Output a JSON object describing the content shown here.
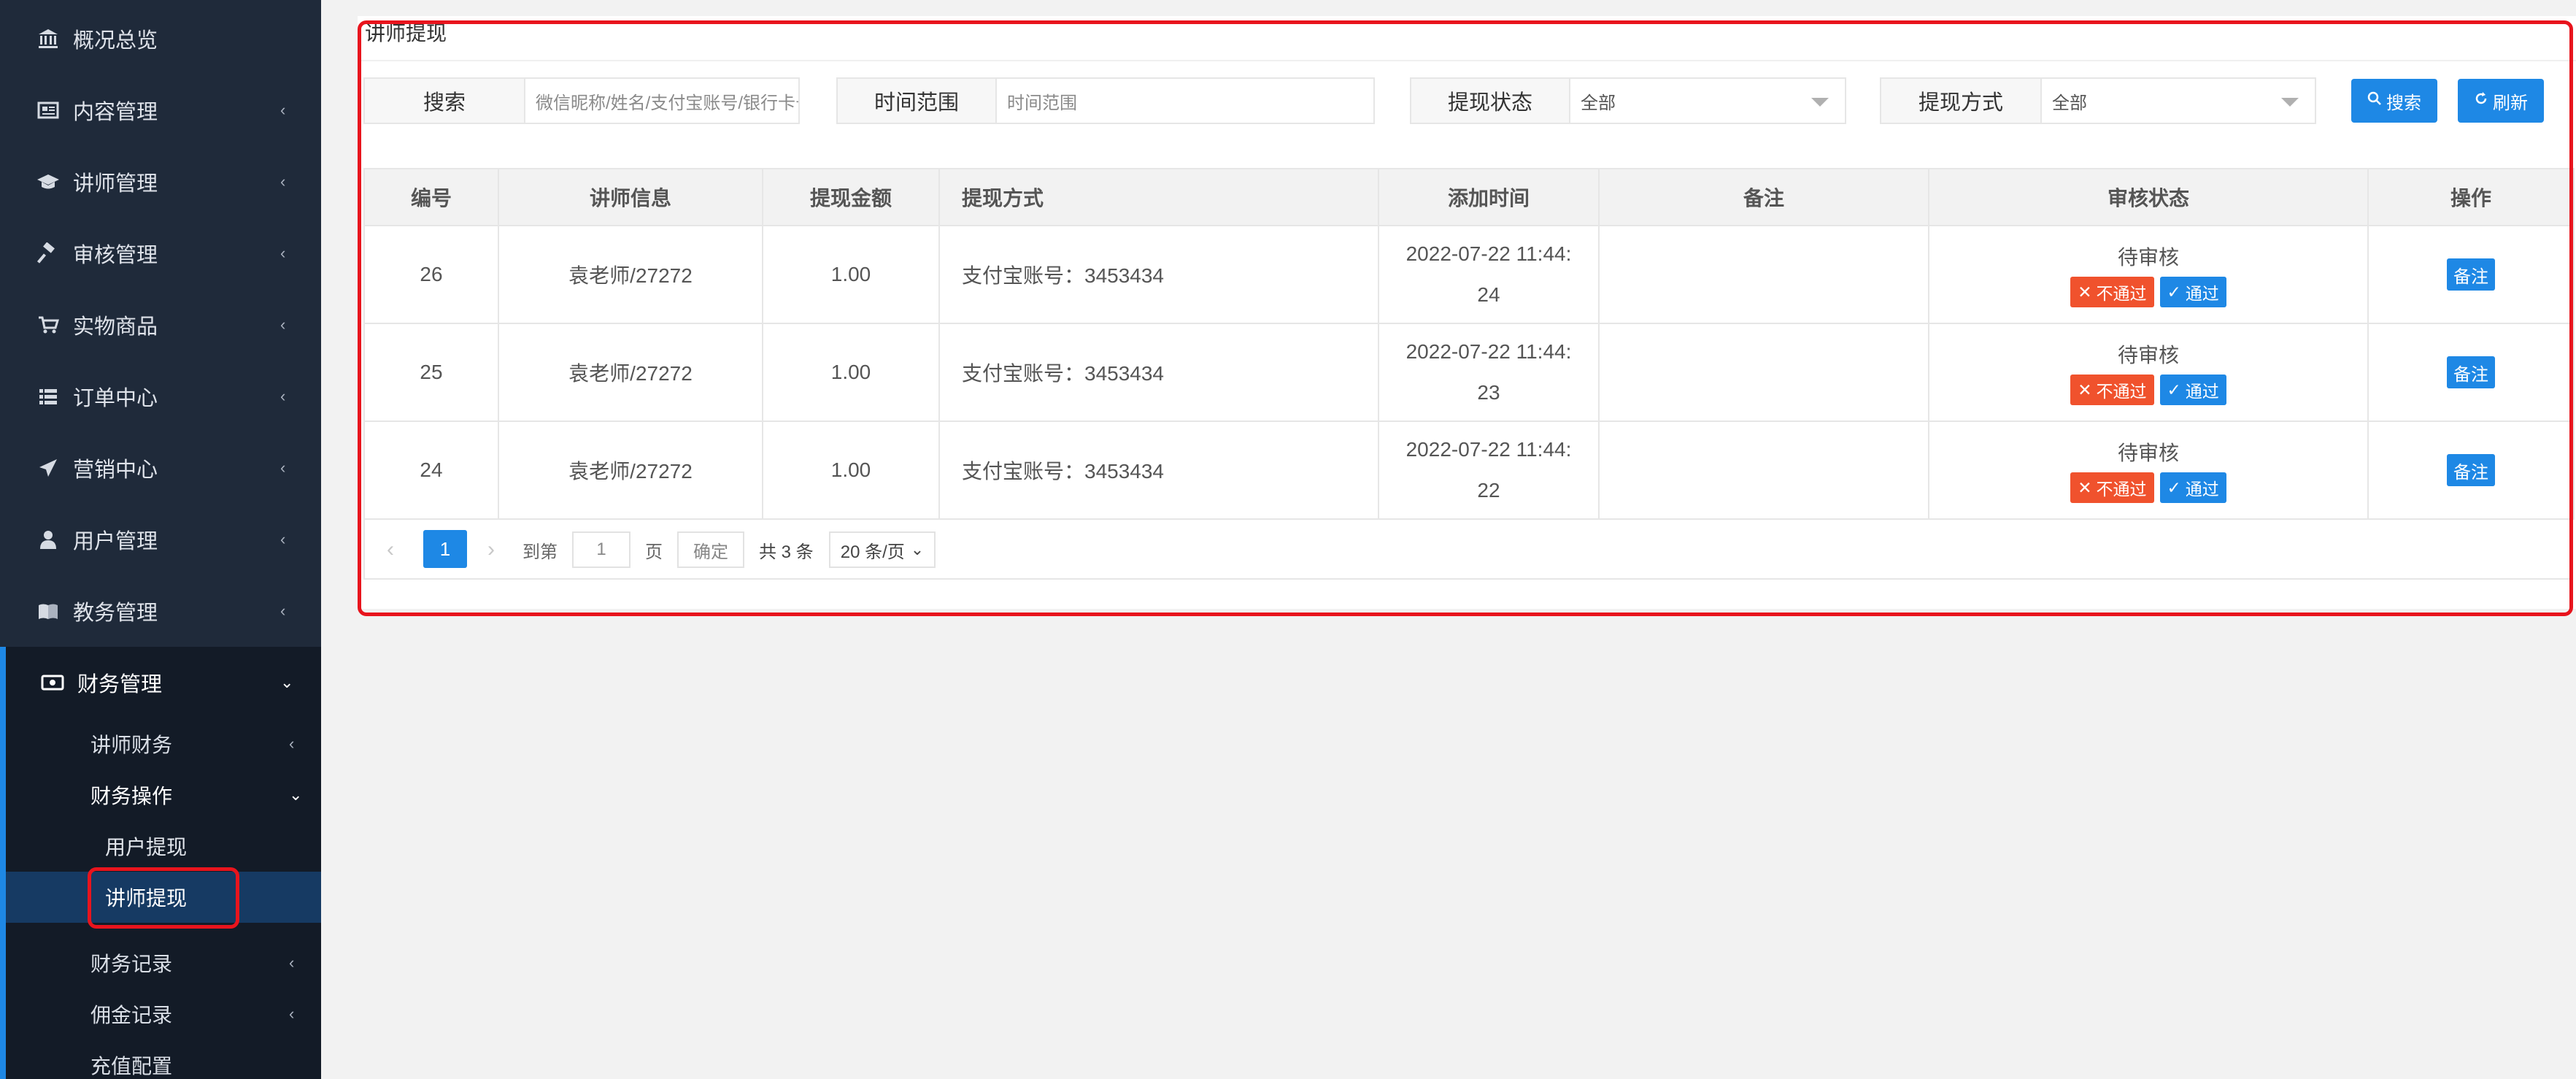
{
  "sidebar": {
    "items": [
      {
        "label": "概况总览",
        "icon": "bank-icon"
      },
      {
        "label": "内容管理",
        "icon": "newspaper-icon"
      },
      {
        "label": "讲师管理",
        "icon": "graduation-cap-icon"
      },
      {
        "label": "审核管理",
        "icon": "gavel-icon"
      },
      {
        "label": "实物商品",
        "icon": "cart-icon"
      },
      {
        "label": "订单中心",
        "icon": "list-icon"
      },
      {
        "label": "营销中心",
        "icon": "paper-plane-icon"
      },
      {
        "label": "用户管理",
        "icon": "user-icon"
      },
      {
        "label": "教务管理",
        "icon": "book-icon"
      },
      {
        "label": "财务管理",
        "icon": "money-icon"
      }
    ],
    "finance_sub": [
      {
        "label": "讲师财务"
      },
      {
        "label": "财务操作"
      }
    ],
    "finance_ops_sub": [
      {
        "label": "用户提现"
      },
      {
        "label": "讲师提现"
      }
    ],
    "finance_sub_more": [
      {
        "label": "财务记录"
      },
      {
        "label": "佣金记录"
      },
      {
        "label": "充值配置"
      }
    ]
  },
  "page": {
    "title": "讲师提现"
  },
  "filters": {
    "search_label": "搜索",
    "search_placeholder": "微信昵称/姓名/支付宝账号/银行卡号",
    "time_label": "时间范围",
    "time_placeholder": "时间范围",
    "status_label": "提现状态",
    "status_value": "全部",
    "method_label": "提现方式",
    "method_value": "全部",
    "search_button": "搜索",
    "refresh_button": "刷新"
  },
  "table": {
    "headers": [
      "编号",
      "讲师信息",
      "提现金额",
      "提现方式",
      "添加时间",
      "备注",
      "审核状态",
      "操作"
    ],
    "rows": [
      {
        "id": "26",
        "teacher": "袁老师/27272",
        "amount": "1.00",
        "method": "支付宝账号：3453434",
        "time1": "2022-07-22 11:44:",
        "time2": "24",
        "note": "",
        "status": "待审核",
        "reject": "不通过",
        "pass": "通过",
        "action": "备注"
      },
      {
        "id": "25",
        "teacher": "袁老师/27272",
        "amount": "1.00",
        "method": "支付宝账号：3453434",
        "time1": "2022-07-22 11:44:",
        "time2": "23",
        "note": "",
        "status": "待审核",
        "reject": "不通过",
        "pass": "通过",
        "action": "备注"
      },
      {
        "id": "24",
        "teacher": "袁老师/27272",
        "amount": "1.00",
        "method": "支付宝账号：3453434",
        "time1": "2022-07-22 11:44:",
        "time2": "22",
        "note": "",
        "status": "待审核",
        "reject": "不通过",
        "pass": "通过",
        "action": "备注"
      }
    ]
  },
  "pagination": {
    "current_page": "1",
    "goto_label": "到第",
    "goto_value": "1",
    "page_unit": "页",
    "confirm": "确定",
    "total": "共 3 条",
    "per_page": "20 条/页"
  },
  "colors": {
    "sidebar_bg": "#1f2a3a",
    "accent": "#1e88e5",
    "reject": "#f0522d",
    "annotation": "#e8141d"
  }
}
